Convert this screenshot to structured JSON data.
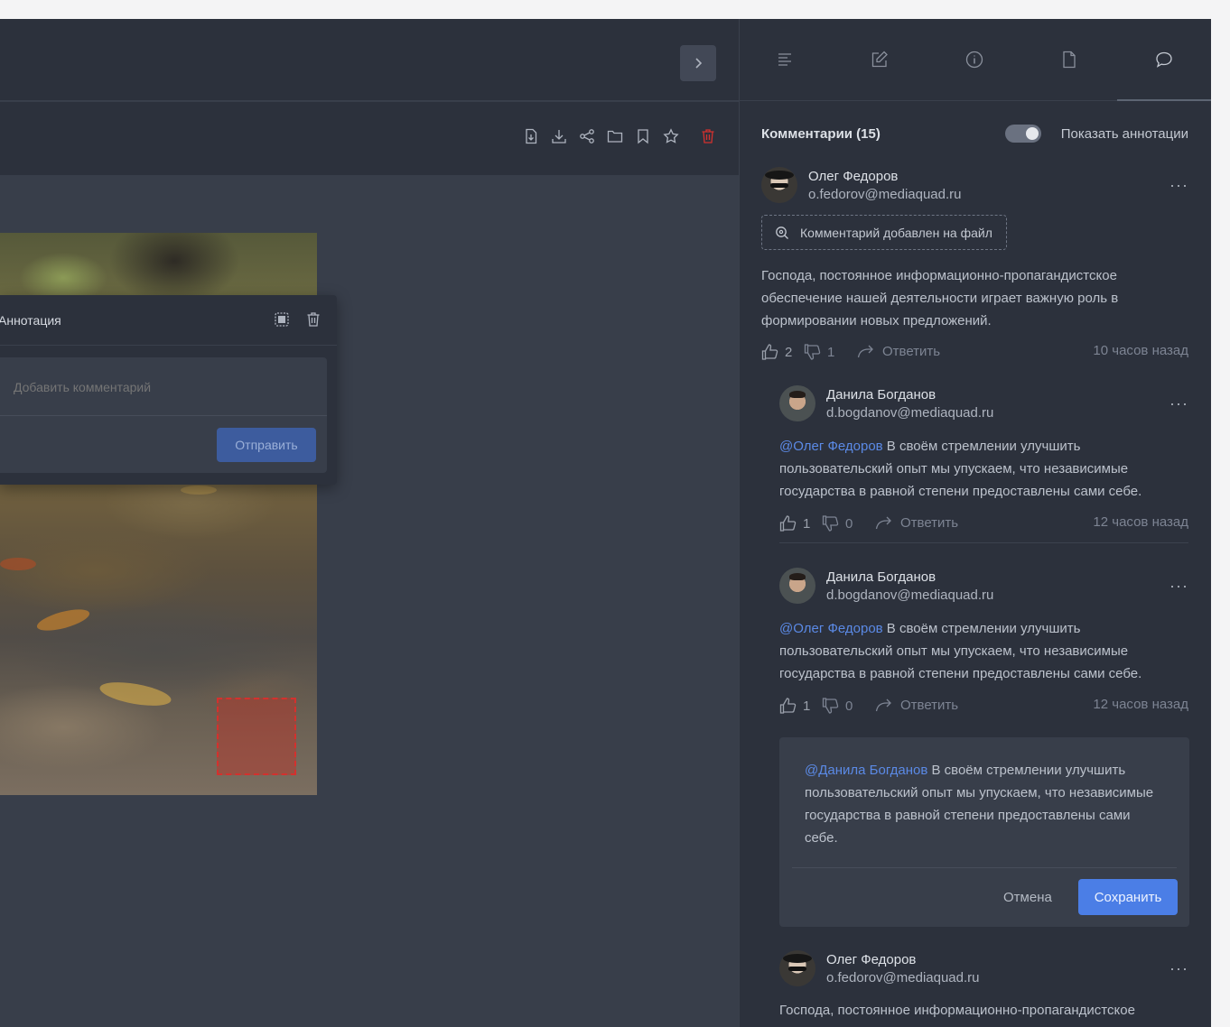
{
  "viewer": {
    "toolbar_icons": [
      "file-export-icon",
      "download-icon",
      "share-icon",
      "folder-icon",
      "bookmark-icon",
      "star-icon",
      "trash-icon"
    ],
    "annotation_popup": {
      "title": "Аннотация",
      "input_placeholder": "Добавить комментарий",
      "send_label": "Отправить"
    }
  },
  "sidebar": {
    "tabs": [
      "text-lines-icon",
      "edit-icon",
      "info-icon",
      "file-icon",
      "comment-icon"
    ],
    "active_tab": "comment-icon",
    "comments_title": "Комментарии (15)",
    "show_annotations_label": "Показать аннотации",
    "show_annotations_on": true,
    "comments": [
      {
        "author": "Олег Федоров",
        "email": "o.fedorov@mediaquad.ru",
        "chip": "Комментарий добавлен на файл",
        "text": "Господа, постоянное информационно-пропагандистское обеспечение нашей деятельности играет важную роль в формировании новых предложений.",
        "likes": "2",
        "dislikes": "1",
        "reply_label": "Ответить",
        "time": "10 часов назад"
      },
      {
        "author": "Данила Богданов",
        "email": "d.bogdanov@mediaquad.ru",
        "mention": "@Олег Федоров",
        "text": " В своём стремлении улучшить пользовательский опыт мы упускаем, что независимые государства в равной степени предоставлены сами себе.",
        "likes": "1",
        "dislikes": "0",
        "reply_label": "Ответить",
        "time": "12 часов назад"
      },
      {
        "author": "Данила Богданов",
        "email": "d.bogdanov@mediaquad.ru",
        "mention": "@Олег Федоров",
        "text": " В своём стремлении улучшить пользовательский опыт мы упускаем, что независимые государства в равной степени предоставлены сами себе.",
        "likes": "1",
        "dislikes": "0",
        "reply_label": "Ответить",
        "time": "12 часов назад"
      },
      {
        "author": "Олег Федоров",
        "email": "o.fedorov@mediaquad.ru",
        "text": "Господа, постоянное информационно-пропагандистское"
      }
    ],
    "edit_reply": {
      "mention": "@Данила Богданов",
      "text": " В своём стремлении улучшить пользовательский опыт мы упускаем, что независимые государства в равной степени предоставлены сами себе.",
      "cancel_label": "Отмена",
      "save_label": "Сохранить"
    }
  },
  "colors": {
    "accent": "#4b7ee6",
    "mention": "#5b8ae6",
    "danger": "#d3312e",
    "panel": "#2c313c",
    "stage": "#383e4a"
  }
}
